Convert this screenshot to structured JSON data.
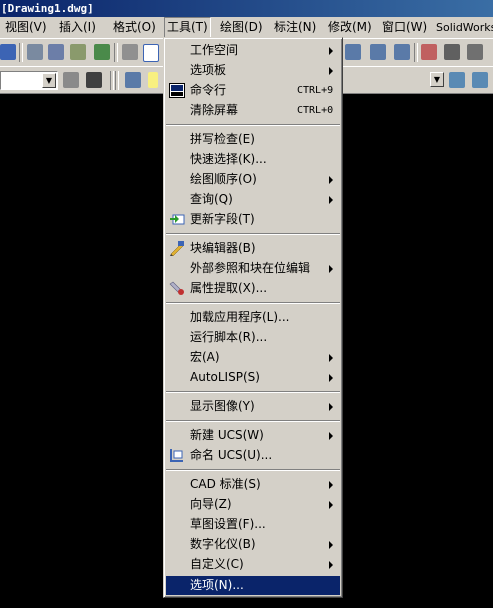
{
  "window": {
    "title": "[Drawing1.dwg]"
  },
  "menubar": {
    "items": [
      {
        "label": "视图(V)"
      },
      {
        "label": "插入(I)"
      },
      {
        "label": "格式(O)"
      },
      {
        "label": "工具(T)"
      },
      {
        "label": "绘图(D)"
      },
      {
        "label": "标注(N)"
      },
      {
        "label": "修改(M)"
      },
      {
        "label": "窗口(W)"
      },
      {
        "label": "SolidWorks"
      }
    ]
  },
  "tools_menu": {
    "items": [
      {
        "label": "工作空间"
      },
      {
        "label": "选项板"
      },
      {
        "label": "命令行",
        "shortcut": "CTRL+9"
      },
      {
        "label": "清除屏幕",
        "shortcut": "CTRL+0"
      },
      {
        "label": "拼写检查(E)"
      },
      {
        "label": "快速选择(K)..."
      },
      {
        "label": "绘图顺序(O)"
      },
      {
        "label": "查询(Q)"
      },
      {
        "label": "更新字段(T)"
      },
      {
        "label": "块编辑器(B)"
      },
      {
        "label": "外部参照和块在位编辑"
      },
      {
        "label": "属性提取(X)..."
      },
      {
        "label": "加载应用程序(L)..."
      },
      {
        "label": "运行脚本(R)..."
      },
      {
        "label": "宏(A)"
      },
      {
        "label": "AutoLISP(S)"
      },
      {
        "label": "显示图像(Y)"
      },
      {
        "label": "新建 UCS(W)"
      },
      {
        "label": "命名 UCS(U)..."
      },
      {
        "label": "CAD 标准(S)"
      },
      {
        "label": "向导(Z)"
      },
      {
        "label": "草图设置(F)..."
      },
      {
        "label": "数字化仪(B)"
      },
      {
        "label": "自定义(C)"
      },
      {
        "label": "选项(N)..."
      }
    ]
  }
}
